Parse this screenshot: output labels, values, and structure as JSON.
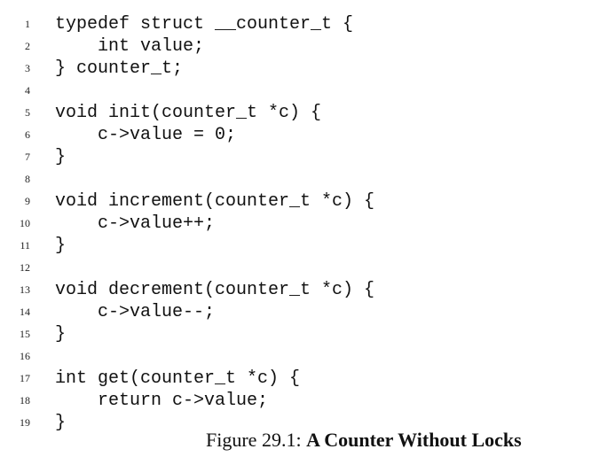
{
  "code_lines": [
    {
      "number": "1",
      "text": "typedef struct __counter_t {"
    },
    {
      "number": "2",
      "text": "    int value;"
    },
    {
      "number": "3",
      "text": "} counter_t;"
    },
    {
      "number": "4",
      "text": ""
    },
    {
      "number": "5",
      "text": "void init(counter_t *c) {"
    },
    {
      "number": "6",
      "text": "    c->value = 0;"
    },
    {
      "number": "7",
      "text": "}"
    },
    {
      "number": "8",
      "text": ""
    },
    {
      "number": "9",
      "text": "void increment(counter_t *c) {"
    },
    {
      "number": "10",
      "text": "    c->value++;"
    },
    {
      "number": "11",
      "text": "}"
    },
    {
      "number": "12",
      "text": ""
    },
    {
      "number": "13",
      "text": "void decrement(counter_t *c) {"
    },
    {
      "number": "14",
      "text": "    c->value--;"
    },
    {
      "number": "15",
      "text": "}"
    },
    {
      "number": "16",
      "text": ""
    },
    {
      "number": "17",
      "text": "int get(counter_t *c) {"
    },
    {
      "number": "18",
      "text": "    return c->value;"
    },
    {
      "number": "19",
      "text": "}"
    }
  ],
  "caption": {
    "label": "Figure 29.1:",
    "title": "A Counter Without Locks"
  }
}
